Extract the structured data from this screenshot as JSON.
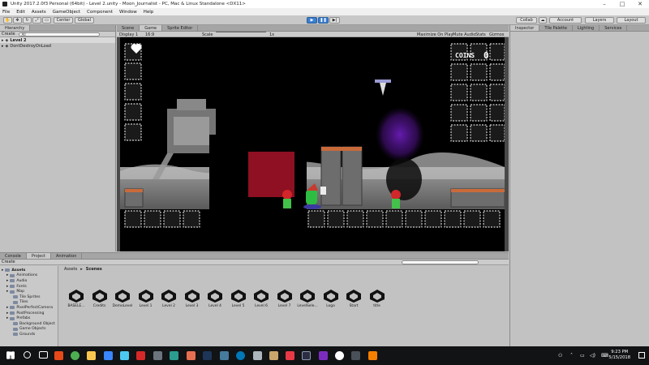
{
  "window": {
    "title": "Unity 2017.2.0f3 Personal (64bit) - Level 2.unity - Moon_Journalist - PC, Mac & Linux Standalone <DX11>"
  },
  "menu": [
    "File",
    "Edit",
    "Assets",
    "GameObject",
    "Component",
    "Window",
    "Help"
  ],
  "toolbar": {
    "center_label": "Center",
    "global_label": "Global",
    "collab_label": "Collab",
    "account_label": "Account",
    "layers_label": "Layers",
    "layout_label": "Layout"
  },
  "hierarchy": {
    "tab": "Hierarchy",
    "create_label": "Create",
    "search_placeholder": "All",
    "rows": [
      {
        "label": "Level 2"
      },
      {
        "label": "DontDestroyOnLoad"
      }
    ]
  },
  "gameview": {
    "tabs": [
      "Scene",
      "Game",
      "Sprite Editor"
    ],
    "display_label": "Display 1",
    "aspect_label": "16:9",
    "scale_label": "Scale",
    "scale_value": "1x",
    "maximize_label": "Maximize On Play",
    "mute_label": "Mute Audio",
    "stats_label": "Stats",
    "gizmos_label": "Gizmos",
    "hud": {
      "coins_label": "COINS",
      "coins_value": "0"
    }
  },
  "inspector": {
    "tabs": [
      "Inspector",
      "Tile Palette",
      "Lighting",
      "Services"
    ]
  },
  "project": {
    "tabs": [
      "Console",
      "Project",
      "Animation"
    ],
    "create_label": "Create",
    "breadcrumb": [
      "Assets",
      "Scenes"
    ],
    "tree": [
      {
        "label": "Assets",
        "depth": 0
      },
      {
        "label": "Animations",
        "depth": 1
      },
      {
        "label": "Audio",
        "depth": 1
      },
      {
        "label": "Fonts",
        "depth": 1
      },
      {
        "label": "Map",
        "depth": 1
      },
      {
        "label": "Tile Sprites",
        "depth": 2
      },
      {
        "label": "Tiles",
        "depth": 2
      },
      {
        "label": "PixelPerfectCamera",
        "depth": 1
      },
      {
        "label": "PostProcessing",
        "depth": 1
      },
      {
        "label": "Prefabs",
        "depth": 1
      },
      {
        "label": "Background Object",
        "depth": 2
      },
      {
        "label": "Game Objects",
        "depth": 2
      },
      {
        "label": "Grounds",
        "depth": 2
      }
    ],
    "scenes": [
      "BASELE...",
      "Credits",
      "DemoLevel",
      "Level 1",
      "Level 2",
      "Level 3",
      "Level 4",
      "Level 5",
      "Level 6",
      "Level 7",
      "LevelSele...",
      "Logo",
      "Start",
      "title"
    ]
  },
  "taskbar": {
    "time": "9:23 PM",
    "date": "5/15/2018"
  }
}
